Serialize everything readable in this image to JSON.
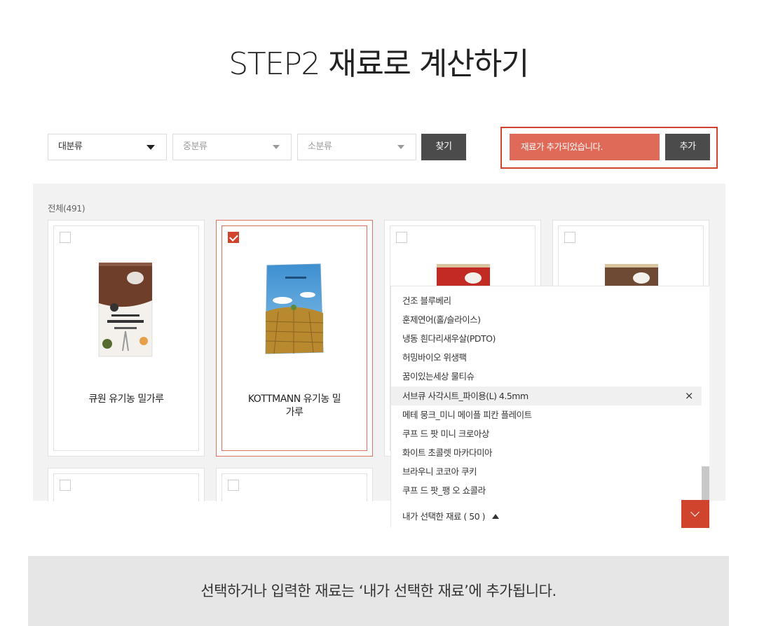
{
  "page": {
    "title": "STEP2 재료로 계산하기"
  },
  "filters": {
    "major": "대분류",
    "middle": "중분류",
    "minor": "소분류",
    "search_label": "찾기"
  },
  "add_panel": {
    "message": "재료가 추가되었습니다.",
    "add_label": "추가"
  },
  "list": {
    "total": "전체(491)",
    "products": [
      {
        "name": "큐원 유기농 밀가루",
        "checked": false,
        "brand_text": "큐원",
        "bag_label": "유기농 밀가루",
        "bag_sub": "고급강력",
        "bag_weight": "20kg"
      },
      {
        "name": "KOTTMANN 유기농 밀가루",
        "checked": true
      },
      {
        "name": "",
        "checked": false
      },
      {
        "name": "",
        "checked": false
      },
      {
        "name": "",
        "checked": false
      },
      {
        "name": "",
        "checked": false
      }
    ]
  },
  "selected_dropdown": {
    "items": [
      "건조 블루베리",
      "훈제연어(홀/슬라이스)",
      "냉동 흰다리새우살(PDTO)",
      "허밍바이오 위생팩",
      "꿈이있는세상 물티슈",
      "서브큐 사각시트_파이용(L) 4.5mm",
      "메테 뭉크_미니 메이플 피칸 플레이트",
      "쿠프 드 팟 미니 크로아상",
      "화이트 초콜렛 마카다미아",
      "브라우니 코코아 쿠키",
      "쿠프 드 팟_팽 오 쇼콜라"
    ],
    "hover_index": 5,
    "remove_icon": "×",
    "footer": "내가 선택한 재료 ( 50 )"
  },
  "banner": {
    "text": "선택하거나 입력한 재료는 ‘내가 선택한 재료’에 추가됩니다."
  },
  "colors": {
    "accent": "#d0442e",
    "message_bg": "#e06a58",
    "dark_button": "#4b4b4b",
    "panel_bg": "#f2f2f2",
    "banner_bg": "#e6e6e6"
  }
}
